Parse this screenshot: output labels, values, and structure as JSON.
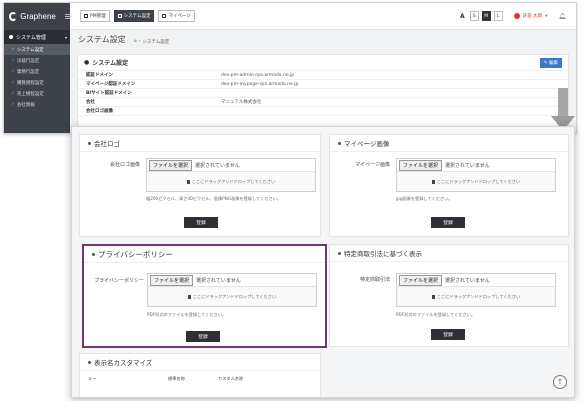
{
  "app": {
    "name": "Graphene"
  },
  "sidebar": {
    "section": "システム管理",
    "items": [
      {
        "label": "システム設定",
        "active": true
      },
      {
        "label": "決裁行設定",
        "active": false
      },
      {
        "label": "業務行設定",
        "active": false
      },
      {
        "label": "購買規程設定",
        "active": false
      },
      {
        "label": "売上規程設定",
        "active": false
      },
      {
        "label": "会社情報",
        "active": false
      }
    ]
  },
  "topbar": {
    "tabs": [
      {
        "label": "PM管理",
        "dark": false
      },
      {
        "label": "システム設定",
        "dark": true
      },
      {
        "label": "マイページ",
        "dark": false
      }
    ],
    "font_size_label": "A",
    "font_sizes": [
      {
        "label": "S",
        "on": false
      },
      {
        "label": "M",
        "on": true
      },
      {
        "label": "L",
        "on": false
      }
    ],
    "user_name": "許容 太郎",
    "user_caret": "▾",
    "bell_icon": "bell-icon"
  },
  "back_page": {
    "title": "システム設定",
    "breadcrumb": [
      "⌂",
      "システム設定"
    ],
    "card_title": "システム設定",
    "edit_label": "✎ 編集",
    "rows": [
      {
        "key": "認証ドメイン",
        "value": "dev-pm-admin-rpa.armada.ne.jp"
      },
      {
        "key": "マイページ認証ドメイン",
        "value": "dev-pm-mypage-rpa.armada.ne.jp"
      },
      {
        "key": "BIサイト認証ドメイン",
        "value": ""
      },
      {
        "key": "会社",
        "value": "マニュアル株式会社"
      },
      {
        "key": "会社ロゴ画像",
        "value": ""
      }
    ]
  },
  "front_page": {
    "file_choose_label": "ファイルを選択",
    "no_file_label": "選択されていません",
    "drop_hint": "ここにドラッグアンドドロップしてください",
    "register_label": "登録",
    "panels": {
      "company_logo": {
        "title": "会社ロゴ",
        "field_label": "会社ロゴ画像",
        "note": "幅200ピクセル、高さ40ピクセル、画像PNG画像を登録してください。"
      },
      "mypage_image": {
        "title": "マイページ画像",
        "field_label": "マイページ画像",
        "note": "jpg画像を登録してください。"
      },
      "privacy_policy": {
        "title": "プライバシーポリシー",
        "field_label": "プライバシーポリシー",
        "note": "PDF形式のファイルを登録してください。"
      },
      "tokushoho": {
        "title": "特定商取引法に基づく表示",
        "field_label": "特定商取引法",
        "note": "PDF形式のファイルを登録してください。"
      },
      "display_names": {
        "title": "表示名カスタマイズ",
        "columns": [
          "キー",
          "標準名称",
          "カスタム名称"
        ]
      }
    },
    "scroll_top_icon": "arrow-up-icon"
  },
  "colors": {
    "highlight_border": "#6b3b6e",
    "sidebar": "#3d4249",
    "edit_button": "#3b76c7",
    "register_button": "#2d3035"
  }
}
